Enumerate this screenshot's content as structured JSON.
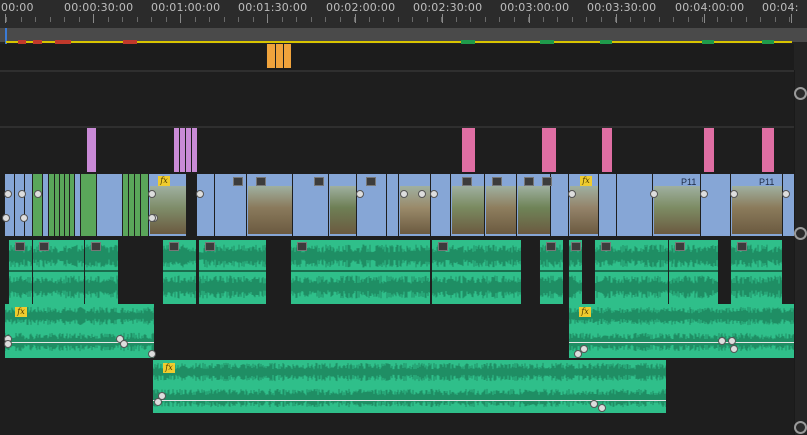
{
  "ruler": {
    "timecodes": [
      "00:00",
      "00:00:30:00",
      "00:01:00:00",
      "00:01:30:00",
      "00:02:00:00",
      "00:02:30:00",
      "00:03:00:00",
      "00:03:30:00",
      "00:04:00:00",
      "00:04:"
    ]
  },
  "colors": {
    "background": "#232323",
    "video_clip": "#86a6d6",
    "audio_clip": "#2fbf8a",
    "green_clip": "#5aa65a",
    "pink_clip": "#df6ea3",
    "lilac_clip": "#c98ad6",
    "orange_clip": "#f0a33c",
    "work_area_bar": "#d8c400",
    "fx_badge": "#f0cc2e"
  },
  "clips": {
    "fx_label": "fx",
    "video_labels": [
      "P11",
      "P11"
    ]
  },
  "icons": {
    "clip_icon": "film-strip-icon",
    "effect_badge": "fx-badge-icon",
    "track_scroll": "scroll-circle-icon"
  }
}
